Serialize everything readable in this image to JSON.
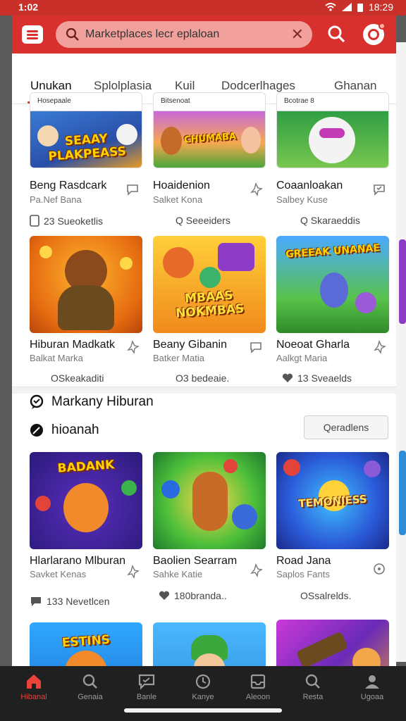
{
  "status": {
    "time": "1:02",
    "right_text": "18:29"
  },
  "search": {
    "value": "Marketplaces lecr eplaloan",
    "placeholder": ""
  },
  "tabs": [
    {
      "label": "Unukan",
      "active": true
    },
    {
      "label": "Splolplasia",
      "active": false
    },
    {
      "label": "Kuil",
      "active": false
    },
    {
      "label": "Dodcerlhages",
      "active": false
    },
    {
      "label": "Ghanan",
      "active": false
    }
  ],
  "grid1": [
    {
      "header": "Hosepaale",
      "art_text": "SEAAY PLAKPEASS",
      "title": "Beng Rasdcark",
      "sub": "Pa.Nef Bana",
      "meta": "23 Sueoketlis",
      "action_icon": "comment-icon",
      "meta_icon": "document-icon"
    },
    {
      "header": "Bitsenoat",
      "art_text": "CHUMABA",
      "title": "Hoaidenion",
      "sub": "Salket Kona",
      "meta": "Q Seeeiders",
      "action_icon": "pin-icon",
      "meta_icon": ""
    },
    {
      "header": "Bcotrae 8",
      "art_text": "",
      "title": "Coaanloakan",
      "sub": "Salbey Kuse",
      "meta": "Q Skaraeddis",
      "action_icon": "check-comment-icon",
      "meta_icon": ""
    }
  ],
  "grid2": [
    {
      "art_text": "",
      "title": "Hiburan Madkatk",
      "sub": "Balkat Marka",
      "meta": "OSkeakaditi",
      "action_icon": "pin-icon",
      "meta_icon": ""
    },
    {
      "art_text": "MBAAS NOKMBAS",
      "title": "Beany Gibanin",
      "sub": "Batker Matia",
      "meta": "O3 bedeaie.",
      "action_icon": "comment-icon",
      "meta_icon": ""
    },
    {
      "art_text": "GREEAK UNANAE",
      "title": "Noeoat Gharla",
      "sub": "Aalkgt Maria",
      "meta": "13 Sveaelds",
      "action_icon": "pin-icon",
      "meta_icon": "heart-icon"
    }
  ],
  "section": {
    "title1": "Markany Hiburan",
    "title2": "hioanah",
    "button": "Qeradlens"
  },
  "grid3": [
    {
      "art_text": "BADANK",
      "title": "Hlarlarano Mlburan",
      "sub": "Savket Kenas",
      "meta": "133 Nevetlcen",
      "action_icon": "pin-icon",
      "meta_icon": "chat-icon"
    },
    {
      "art_text": "",
      "title": "Baolien Searram",
      "sub": "Sahke Katie",
      "meta": "180branda..",
      "action_icon": "pin-icon",
      "meta_icon": "heart-icon"
    },
    {
      "art_text": "TEMONIESS",
      "title": "Road Jana",
      "sub": "Saplos Fants",
      "meta": "OSsalrelds.",
      "action_icon": "target-icon",
      "meta_icon": ""
    }
  ],
  "grid4": [
    {
      "art_text": "ESTINS"
    },
    {
      "art_text": ""
    },
    {
      "art_text": ""
    }
  ],
  "nav": [
    {
      "label": "Hibanal",
      "icon": "home-icon",
      "active": true
    },
    {
      "label": "Genaia",
      "icon": "search-icon",
      "active": false
    },
    {
      "label": "Banle",
      "icon": "chat-bubble-icon",
      "active": false
    },
    {
      "label": "Kanye",
      "icon": "clock-icon",
      "active": false
    },
    {
      "label": "Aleoon",
      "icon": "inbox-icon",
      "active": false
    },
    {
      "label": "Resta",
      "icon": "search-icon",
      "active": false
    },
    {
      "label": "Ugoaa",
      "icon": "profile-icon",
      "active": false
    }
  ],
  "colors": {
    "brand": "#d8302c",
    "nav_bg": "#202020",
    "active_nav": "#e9423b"
  }
}
